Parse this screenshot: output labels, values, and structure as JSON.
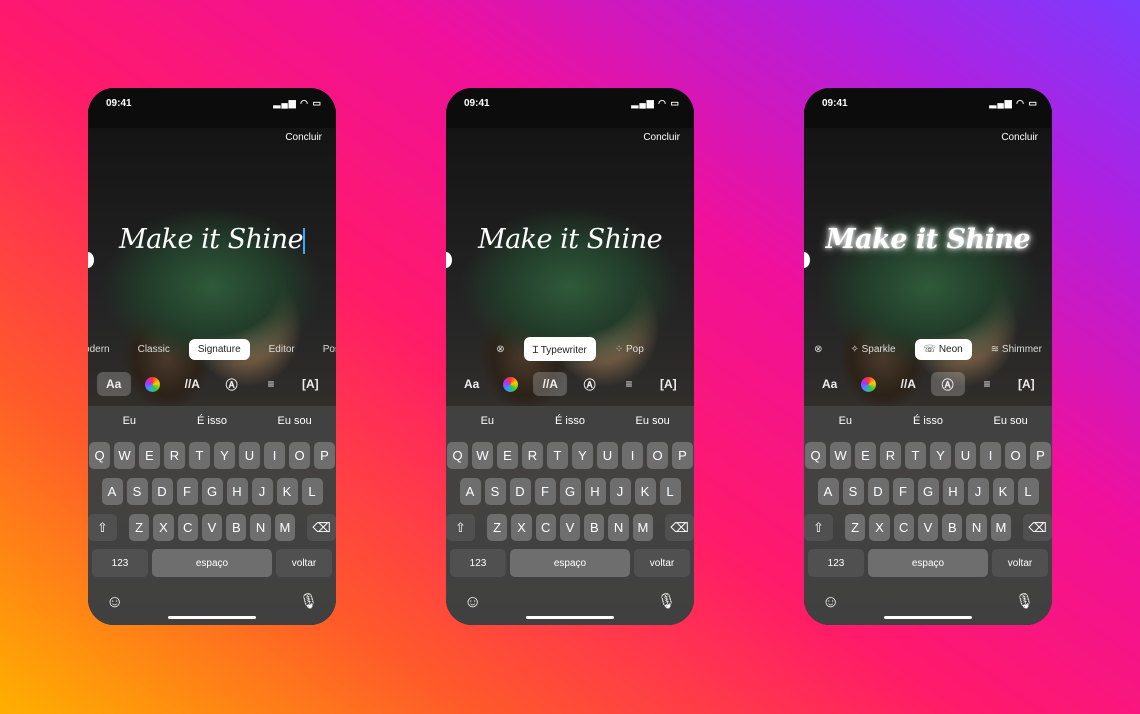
{
  "phones": [
    {
      "time": "09:41",
      "status_icons": "signal wifi battery",
      "done": "Concluir",
      "text": "Make it Shine",
      "effect": "none",
      "caret": true,
      "options": [
        {
          "label": "odern",
          "selected": false
        },
        {
          "label": "Classic",
          "selected": false
        },
        {
          "label": "Signature",
          "selected": true
        },
        {
          "label": "Editor",
          "selected": false
        },
        {
          "label": "Pos",
          "selected": false
        }
      ],
      "selected_tool": 0
    },
    {
      "time": "09:41",
      "status_icons": "signal wifi battery",
      "done": "Concluir",
      "text": "Make it Shine",
      "effect": "none",
      "caret": false,
      "options": [
        {
          "label": "⊗",
          "selected": false
        },
        {
          "label": "Ɪ Typewriter",
          "selected": true
        },
        {
          "label": "⁘ Pop",
          "selected": false
        }
      ],
      "selected_tool": 2
    },
    {
      "time": "09:41",
      "status_icons": "signal wifi battery",
      "done": "Concluir",
      "text": "Make it Shine",
      "effect": "neon",
      "caret": false,
      "options": [
        {
          "label": "⊗",
          "selected": false
        },
        {
          "label": "✧ Sparkle",
          "selected": false
        },
        {
          "label": "☏ Neon",
          "selected": true
        },
        {
          "label": "≋ Shimmer",
          "selected": false
        }
      ],
      "selected_tool": 3
    }
  ],
  "tools": [
    {
      "label": "Aa",
      "icon": "font-icon"
    },
    {
      "label": "",
      "icon": "color-wheel-icon"
    },
    {
      "label": "//A",
      "icon": "animation-icon"
    },
    {
      "label": "Ⓐ",
      "icon": "effects-icon"
    },
    {
      "label": "≡",
      "icon": "align-icon"
    },
    {
      "label": "[A]",
      "icon": "background-icon"
    }
  ],
  "keyboard": {
    "suggestions": [
      "Eu",
      "É isso",
      "Eu sou"
    ],
    "rows": [
      [
        "Q",
        "W",
        "E",
        "R",
        "T",
        "Y",
        "U",
        "I",
        "O",
        "P"
      ],
      [
        "A",
        "S",
        "D",
        "F",
        "G",
        "H",
        "J",
        "K",
        "L"
      ],
      [
        "Z",
        "X",
        "C",
        "V",
        "B",
        "N",
        "M"
      ]
    ],
    "shift": "⇧",
    "delete": "⌫",
    "numbers": "123",
    "space": "espaço",
    "return": "voltar",
    "emoji": "☺",
    "mic": "🎙"
  }
}
